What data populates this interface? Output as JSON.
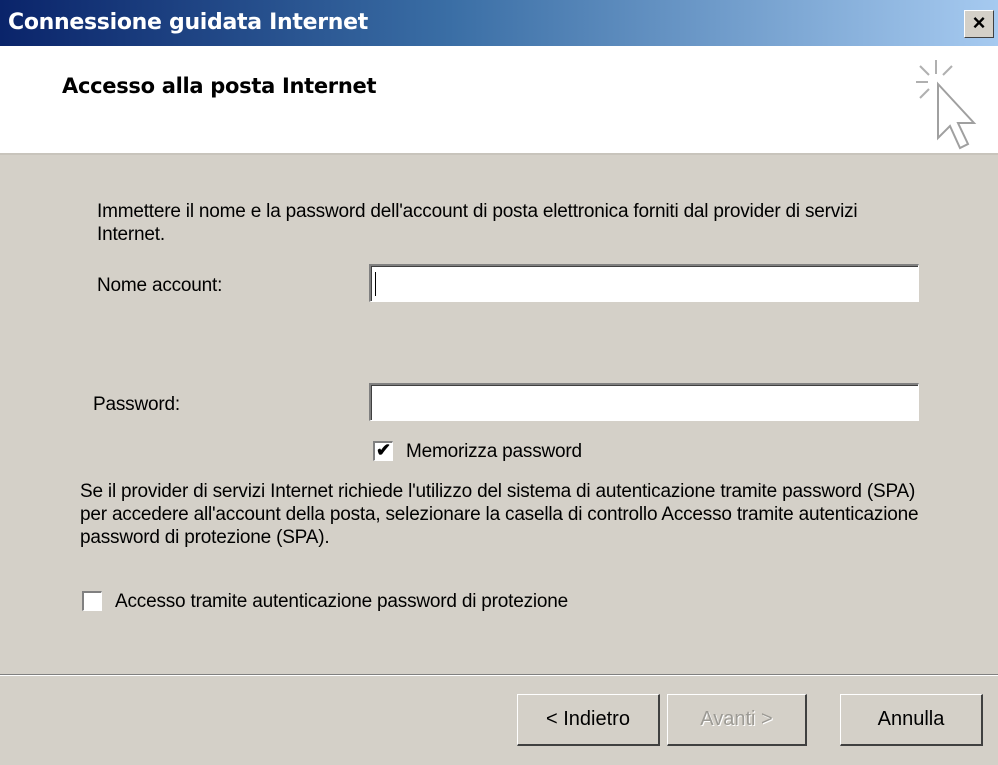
{
  "window": {
    "title": "Connessione guidata Internet",
    "close_glyph": "×"
  },
  "header": {
    "title": "Accesso alla posta Internet",
    "icon": "wizard-cursor-icon"
  },
  "form": {
    "intro": "Immettere il nome e la password dell'account di posta elettronica forniti dal provider di servizi Internet.",
    "account_label": "Nome account:",
    "account_value": "",
    "password_label": "Password:",
    "password_value": "",
    "remember_label": "Memorizza password",
    "remember_checked": true,
    "spa_info": "Se il provider di servizi Internet richiede l'utilizzo del sistema di autenticazione tramite password (SPA) per accedere all'account della posta, selezionare la casella di controllo Accesso tramite autenticazione password di protezione (SPA).",
    "spa_label": "Accesso tramite autenticazione password di protezione",
    "spa_checked": false
  },
  "buttons": {
    "back": "< Indietro",
    "next": "Avanti >",
    "cancel": "Annulla"
  },
  "colors": {
    "titlebar_start": "#0a246a",
    "titlebar_end": "#a6caf0",
    "dialog_bg": "#d4d0c8"
  }
}
